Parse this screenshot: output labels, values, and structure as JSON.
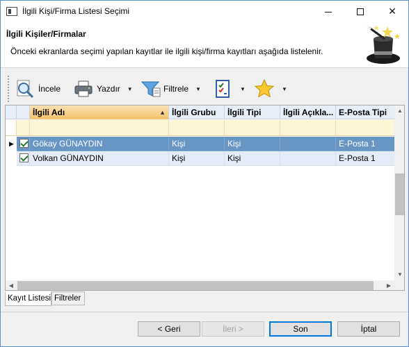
{
  "window": {
    "title": "İlgili Kişi/Firma Listesi Seçimi"
  },
  "header": {
    "title": "İlgili Kişiler/Firmalar",
    "description": "Önceki ekranlarda seçimi yapılan kayıtlar ile ilgili kişi/firma kayıtları aşağıda listelenir."
  },
  "toolbar": {
    "incele": "İncele",
    "yazdir": "Yazdır",
    "filtrele": "Filtrele"
  },
  "grid": {
    "columns": [
      "İlgili Adı",
      "İlgili Grubu",
      "İlgili Tipi",
      "İlgili Açıkla...",
      "E-Posta Tipi"
    ],
    "sort": {
      "column": "İlgili Adı",
      "direction": "ascending"
    },
    "rows": [
      {
        "checked": true,
        "current": true,
        "selected": true,
        "cells": [
          "Gökay GÜNAYDIN",
          "Kişi",
          "Kişi",
          "",
          "E-Posta 1"
        ]
      },
      {
        "checked": true,
        "current": false,
        "selected": false,
        "cells": [
          "Volkan GÜNAYDIN",
          "Kişi",
          "Kişi",
          "",
          "E-Posta 1"
        ]
      }
    ]
  },
  "tabs": [
    {
      "label": "Kayıt Listesi",
      "active": true
    },
    {
      "label": "Filtreler",
      "active": false
    }
  ],
  "buttons": {
    "back": "< Geri",
    "next": "İleri >",
    "finish": "Son",
    "cancel": "İptal"
  }
}
